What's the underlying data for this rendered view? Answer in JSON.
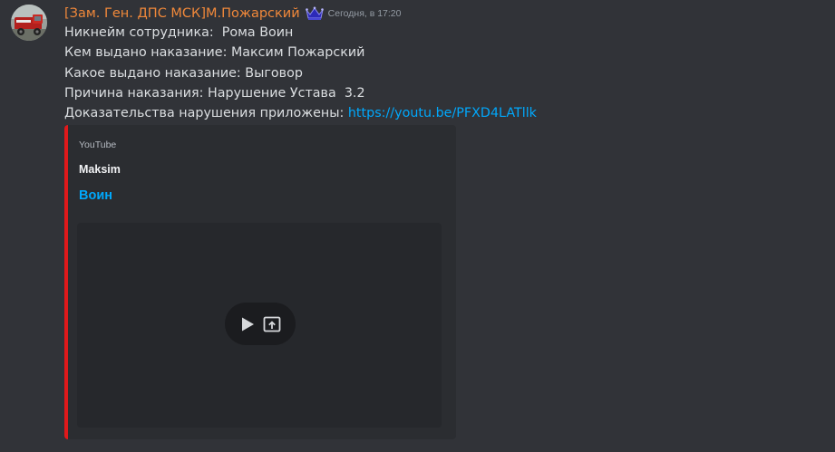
{
  "message": {
    "author": "[Зам. Ген. ДПС МСК]М.Пожарский",
    "timestamp": "Сегодня, в 17:20",
    "lines": [
      "Никнейм сотрудника:  Рома Воин",
      "Кем выдано наказание: Максим Пожарский",
      "Какое выдано наказание: Выговор",
      "Причина наказания: Нарушение Устава  3.2",
      "Доказательства нарушения приложены: "
    ],
    "link": "https://youtu.be/PFXD4LATllk"
  },
  "embed": {
    "provider": "YouTube",
    "author": "Maksim",
    "title": "Воин",
    "accent_color": "#e0191b"
  },
  "icons": {
    "crown": "crown-icon",
    "play": "play-icon",
    "open": "open-external-icon"
  },
  "colors": {
    "background": "#313338",
    "username": "#f0883a",
    "link": "#00a8fc",
    "embed_bg": "#2b2d31"
  }
}
